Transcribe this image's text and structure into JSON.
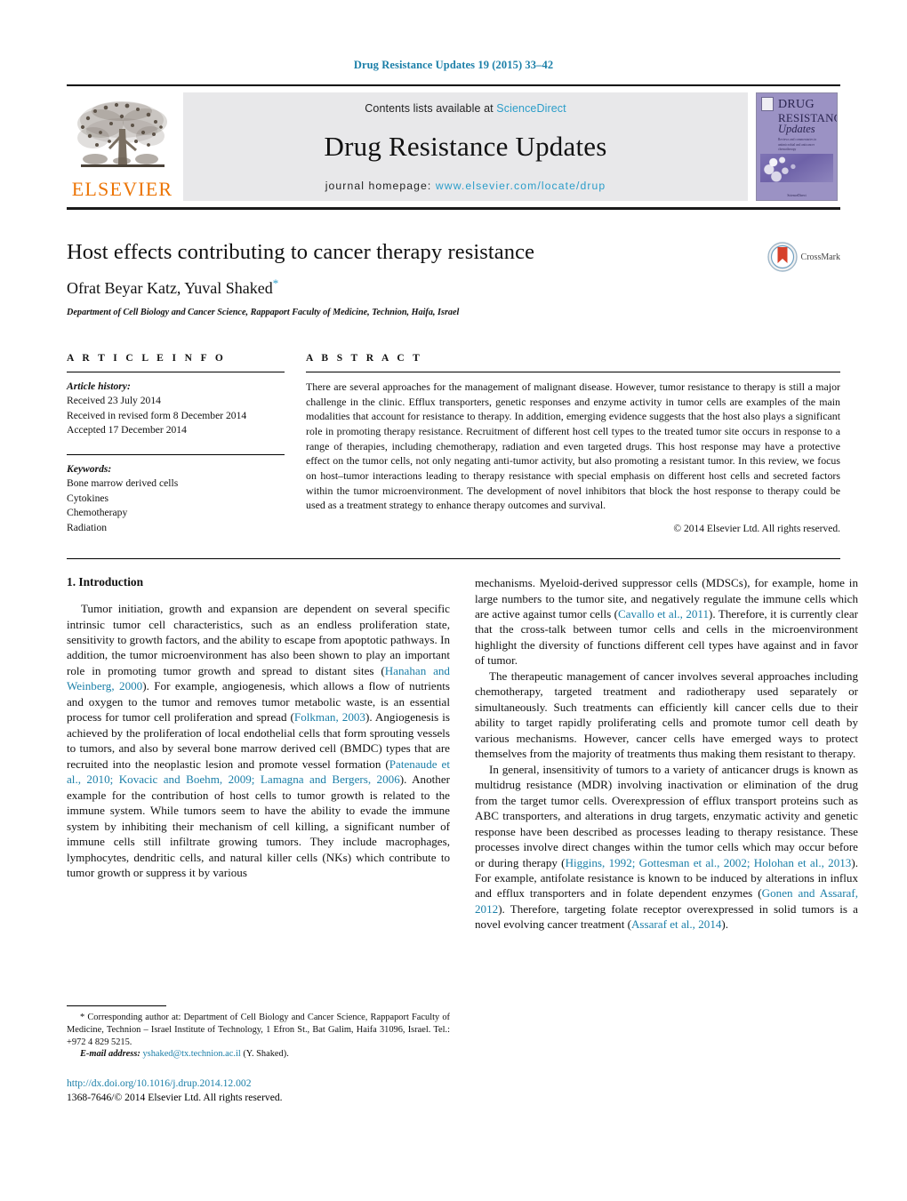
{
  "running_head": "Drug Resistance Updates 19 (2015) 33–42",
  "masthead": {
    "publisher_logo_label": "ELSEVIER",
    "contents_prefix": "Contents lists available at",
    "contents_link": "ScienceDirect",
    "journal_title": "Drug Resistance Updates",
    "homepage_prefix": "journal homepage:",
    "homepage_url": "www.elsevier.com/locate/drup",
    "cover": {
      "line1": "DRUG",
      "line2": "RESISTANCE",
      "line3": "Updates",
      "subtitle": "Reviews and commentaries in antimicrobial and anticancer chemotherapy",
      "footer": "ScienceDirect"
    },
    "link_color": "#2b9dc9",
    "elsevier_orange": "#ec7404"
  },
  "article": {
    "title": "Host effects contributing to cancer therapy resistance",
    "authors": "Ofrat Beyar Katz, Yuval Shaked",
    "corresponding_marker": "*",
    "affiliation": "Department of Cell Biology and Cancer Science, Rappaport Faculty of Medicine, Technion, Haifa, Israel",
    "crossmark_label": "CrossMark"
  },
  "article_info": {
    "heading": "A R T I C L E    I N F O",
    "history_label": "Article history:",
    "history": [
      "Received 23 July 2014",
      "Received in revised form 8 December 2014",
      "Accepted 17 December 2014"
    ],
    "keywords_label": "Keywords:",
    "keywords": [
      "Bone marrow derived cells",
      "Cytokines",
      "Chemotherapy",
      "Radiation"
    ]
  },
  "abstract": {
    "heading": "A B S T R A C T",
    "text": "There are several approaches for the management of malignant disease. However, tumor resistance to therapy is still a major challenge in the clinic. Efflux transporters, genetic responses and enzyme activity in tumor cells are examples of the main modalities that account for resistance to therapy. In addition, emerging evidence suggests that the host also plays a significant role in promoting therapy resistance. Recruitment of different host cell types to the treated tumor site occurs in response to a range of therapies, including chemotherapy, radiation and even targeted drugs. This host response may have a protective effect on the tumor cells, not only negating anti-tumor activity, but also promoting a resistant tumor. In this review, we focus on host–tumor interactions leading to therapy resistance with special emphasis on different host cells and secreted factors within the tumor microenvironment. The development of novel inhibitors that block the host response to therapy could be used as a treatment strategy to enhance therapy outcomes and survival.",
    "copyright": "© 2014 Elsevier Ltd. All rights reserved."
  },
  "body": {
    "section_title": "1. Introduction",
    "left_paragraph_1_a": "Tumor initiation, growth and expansion are dependent on several specific intrinsic tumor cell characteristics, such as an endless proliferation state, sensitivity to growth factors, and the ability to escape from apoptotic pathways. In addition, the tumor microenvironment has also been shown to play an important role in promoting tumor growth and spread to distant sites (",
    "ref_hanahan": "Hanahan and Weinberg, 2000",
    "left_paragraph_1_b": "). For example, angiogenesis, which allows a flow of nutrients and oxygen to the tumor and removes tumor metabolic waste, is an essential process for tumor cell proliferation and spread (",
    "ref_folkman": "Folkman, 2003",
    "left_paragraph_1_c": "). Angiogenesis is achieved by the proliferation of local endothelial cells that form sprouting vessels to tumors, and also by several bone marrow derived cell (BMDC) types that are recruited into the neoplastic lesion and promote vessel formation (",
    "ref_patenaude": "Patenaude et al., 2010; Kovacic and Boehm, 2009; Lamagna and Bergers, 2006",
    "left_paragraph_1_d": "). Another example for the contribution of host cells to tumor growth is related to the immune system. While tumors seem to have the ability to evade the immune system by inhibiting their mechanism of cell killing, a significant number of immune cells still infiltrate growing tumors. They include macrophages, lymphocytes, dendritic cells, and natural killer cells (NKs) which contribute to tumor growth or suppress it by various",
    "right_paragraph_1_a": "mechanisms. Myeloid-derived suppressor cells (MDSCs), for example, home in large numbers to the tumor site, and negatively regulate the immune cells which are active against tumor cells (",
    "ref_cavallo": "Cavallo et al., 2011",
    "right_paragraph_1_b": "). Therefore, it is currently clear that the cross-talk between tumor cells and cells in the microenvironment highlight the diversity of functions different cell types have against and in favor of tumor.",
    "right_paragraph_2": "The therapeutic management of cancer involves several approaches including chemotherapy, targeted treatment and radiotherapy used separately or simultaneously. Such treatments can efficiently kill cancer cells due to their ability to target rapidly proliferating cells and promote tumor cell death by various mechanisms. However, cancer cells have emerged ways to protect themselves from the majority of treatments thus making them resistant to therapy.",
    "right_paragraph_3_a": "In general, insensitivity of tumors to a variety of anticancer drugs is known as multidrug resistance (MDR) involving inactivation or elimination of the drug from the target tumor cells. Overexpression of efflux transport proteins such as ABC transporters, and alterations in drug targets, enzymatic activity and genetic response have been described as processes leading to therapy resistance. These processes involve direct changes within the tumor cells which may occur before or during therapy (",
    "ref_higgins": "Higgins, 1992; Gottesman et al., 2002; Holohan et al., 2013",
    "right_paragraph_3_b": "). For example, antifolate resistance is known to be induced by alterations in influx and efflux transporters and in folate dependent enzymes (",
    "ref_gonen": "Gonen and Assaraf, 2012",
    "right_paragraph_3_c": "). Therefore, targeting folate receptor overexpressed in solid tumors is a novel evolving cancer treatment (",
    "ref_assaraf": "Assaraf et al., 2014",
    "right_paragraph_3_d": ")."
  },
  "footnote": {
    "marker": "*",
    "corresponding_text": " Corresponding author at: Department of Cell Biology and Cancer Science, Rappaport Faculty of Medicine, Technion – Israel Institute of Technology, 1 Efron St., Bat Galim, Haifa 31096, Israel. Tel.: +972 4 829 5215.",
    "email_label": "E-mail address:",
    "email": "yshaked@tx.technion.ac.il",
    "email_suffix": " (Y. Shaked).",
    "doi": "http://dx.doi.org/10.1016/j.drup.2014.12.002",
    "issn_line": "1368-7646/© 2014 Elsevier Ltd. All rights reserved."
  }
}
